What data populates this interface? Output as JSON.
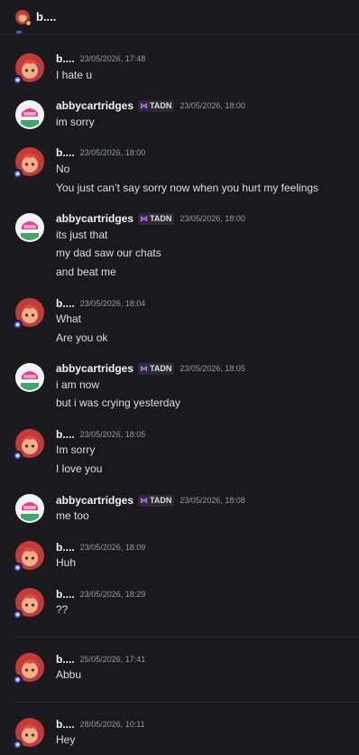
{
  "header": {
    "title": "b...."
  },
  "tag_label": "TADN",
  "messages": [
    {
      "author": "b....",
      "time": "23/05/2026, 17:48",
      "lines": [
        "I hate u"
      ]
    },
    {
      "author": "abbycartridges",
      "time": "23/05/2026, 18:00",
      "lines": [
        "im sorry"
      ]
    },
    {
      "author": "b....",
      "time": "23/05/2026, 18:00",
      "lines": [
        "No",
        "You just can’t say sorry now when you hurt my feelings"
      ]
    },
    {
      "author": "abbycartridges",
      "time": "23/05/2026, 18:00",
      "lines": [
        "its just that",
        "my dad saw our chats",
        "and beat me"
      ]
    },
    {
      "author": "b....",
      "time": "23/05/2026, 18:04",
      "lines": [
        "What",
        "Are you ok"
      ]
    },
    {
      "author": "abbycartridges",
      "time": "23/05/2026, 18:05",
      "lines": [
        "i am now",
        "but i was crying yesterday"
      ]
    },
    {
      "author": "b....",
      "time": "23/05/2026, 18:05",
      "lines": [
        "Im sorry",
        "I love you"
      ]
    },
    {
      "author": "abbycartridges",
      "time": "23/05/2026, 18:08",
      "lines": [
        "me too"
      ]
    },
    {
      "author": "b....",
      "time": "23/05/2026, 18:09",
      "lines": [
        "Huh"
      ]
    },
    {
      "author": "b....",
      "time": "23/05/2026, 18:29",
      "lines": [
        "??"
      ]
    },
    {
      "author": "b....",
      "time": "25/05/2026, 17:41",
      "lines": [
        "Abbu"
      ]
    },
    {
      "author": "b....",
      "time": "28/05/2026, 10:11",
      "lines": [
        "Hey"
      ]
    }
  ],
  "colors": {
    "background": "#1a1a1e",
    "text": "#dbdee1",
    "username": "#f2f3f5",
    "timestamp": "#949ba4",
    "tag_icon": "#c77bff",
    "status_badge": "#5865f2"
  },
  "icons": {
    "b_avatar": "redhead-girl-avatar-icon",
    "abby_avatar": "pink-hair-green-avatar-icon",
    "tag_icon": "bow-icon",
    "status": "activity-badge-icon"
  }
}
